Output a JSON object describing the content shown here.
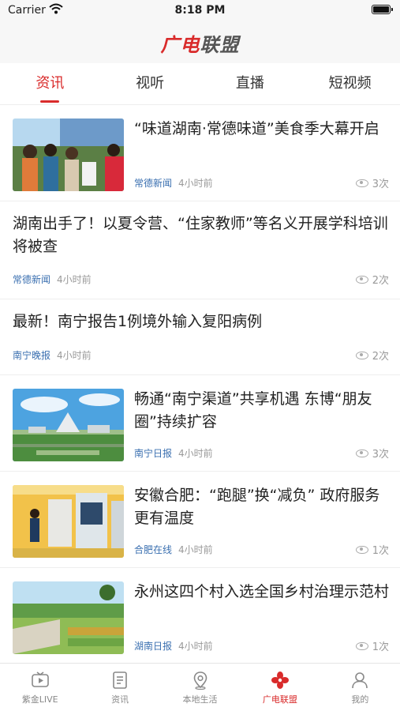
{
  "status": {
    "carrier": "Carrier",
    "time": "8:18 PM"
  },
  "app": {
    "logo_part1": "广电",
    "logo_part2": "联盟"
  },
  "tabs": [
    {
      "label": "资讯",
      "active": true
    },
    {
      "label": "视听",
      "active": false
    },
    {
      "label": "直播",
      "active": false
    },
    {
      "label": "短视频",
      "active": false
    }
  ],
  "feed": [
    {
      "title": "“味道湖南·常德味道”美食季大幕开启",
      "source": "常德新闻",
      "time": "4小时前",
      "views": "3次"
    },
    {
      "title": "湖南出手了！以夏令营、“住家教师”等名义开展学科培训将被查",
      "source": "常德新闻",
      "time": "4小时前",
      "views": "2次"
    },
    {
      "title": "最新！南宁报告1例境外输入复阳病例",
      "source": "南宁晚报",
      "time": "4小时前",
      "views": "2次"
    },
    {
      "title": "畅通“南宁渠道”共享机遇 东博“朋友圈”持续扩容",
      "source": "南宁日报",
      "time": "4小时前",
      "views": "3次"
    },
    {
      "title": "安徽合肥：“跑腿”换“减负” 政府服务更有温度",
      "source": "合肥在线",
      "time": "4小时前",
      "views": "1次"
    },
    {
      "title": "永州这四个村入选全国乡村治理示范村",
      "source": "湖南日报",
      "time": "4小时前",
      "views": "1次"
    }
  ],
  "tabbar": [
    {
      "label": "紫金LIVE",
      "icon": "tv-play-icon",
      "active": false
    },
    {
      "label": "资讯",
      "icon": "news-list-icon",
      "active": false
    },
    {
      "label": "本地生活",
      "icon": "location-pin-icon",
      "active": false
    },
    {
      "label": "广电联盟",
      "icon": "alliance-logo-icon",
      "active": true
    },
    {
      "label": "我的",
      "icon": "person-icon",
      "active": false
    }
  ],
  "colors": {
    "accent": "#d92b2b",
    "source_blue": "#3a6fb0"
  }
}
